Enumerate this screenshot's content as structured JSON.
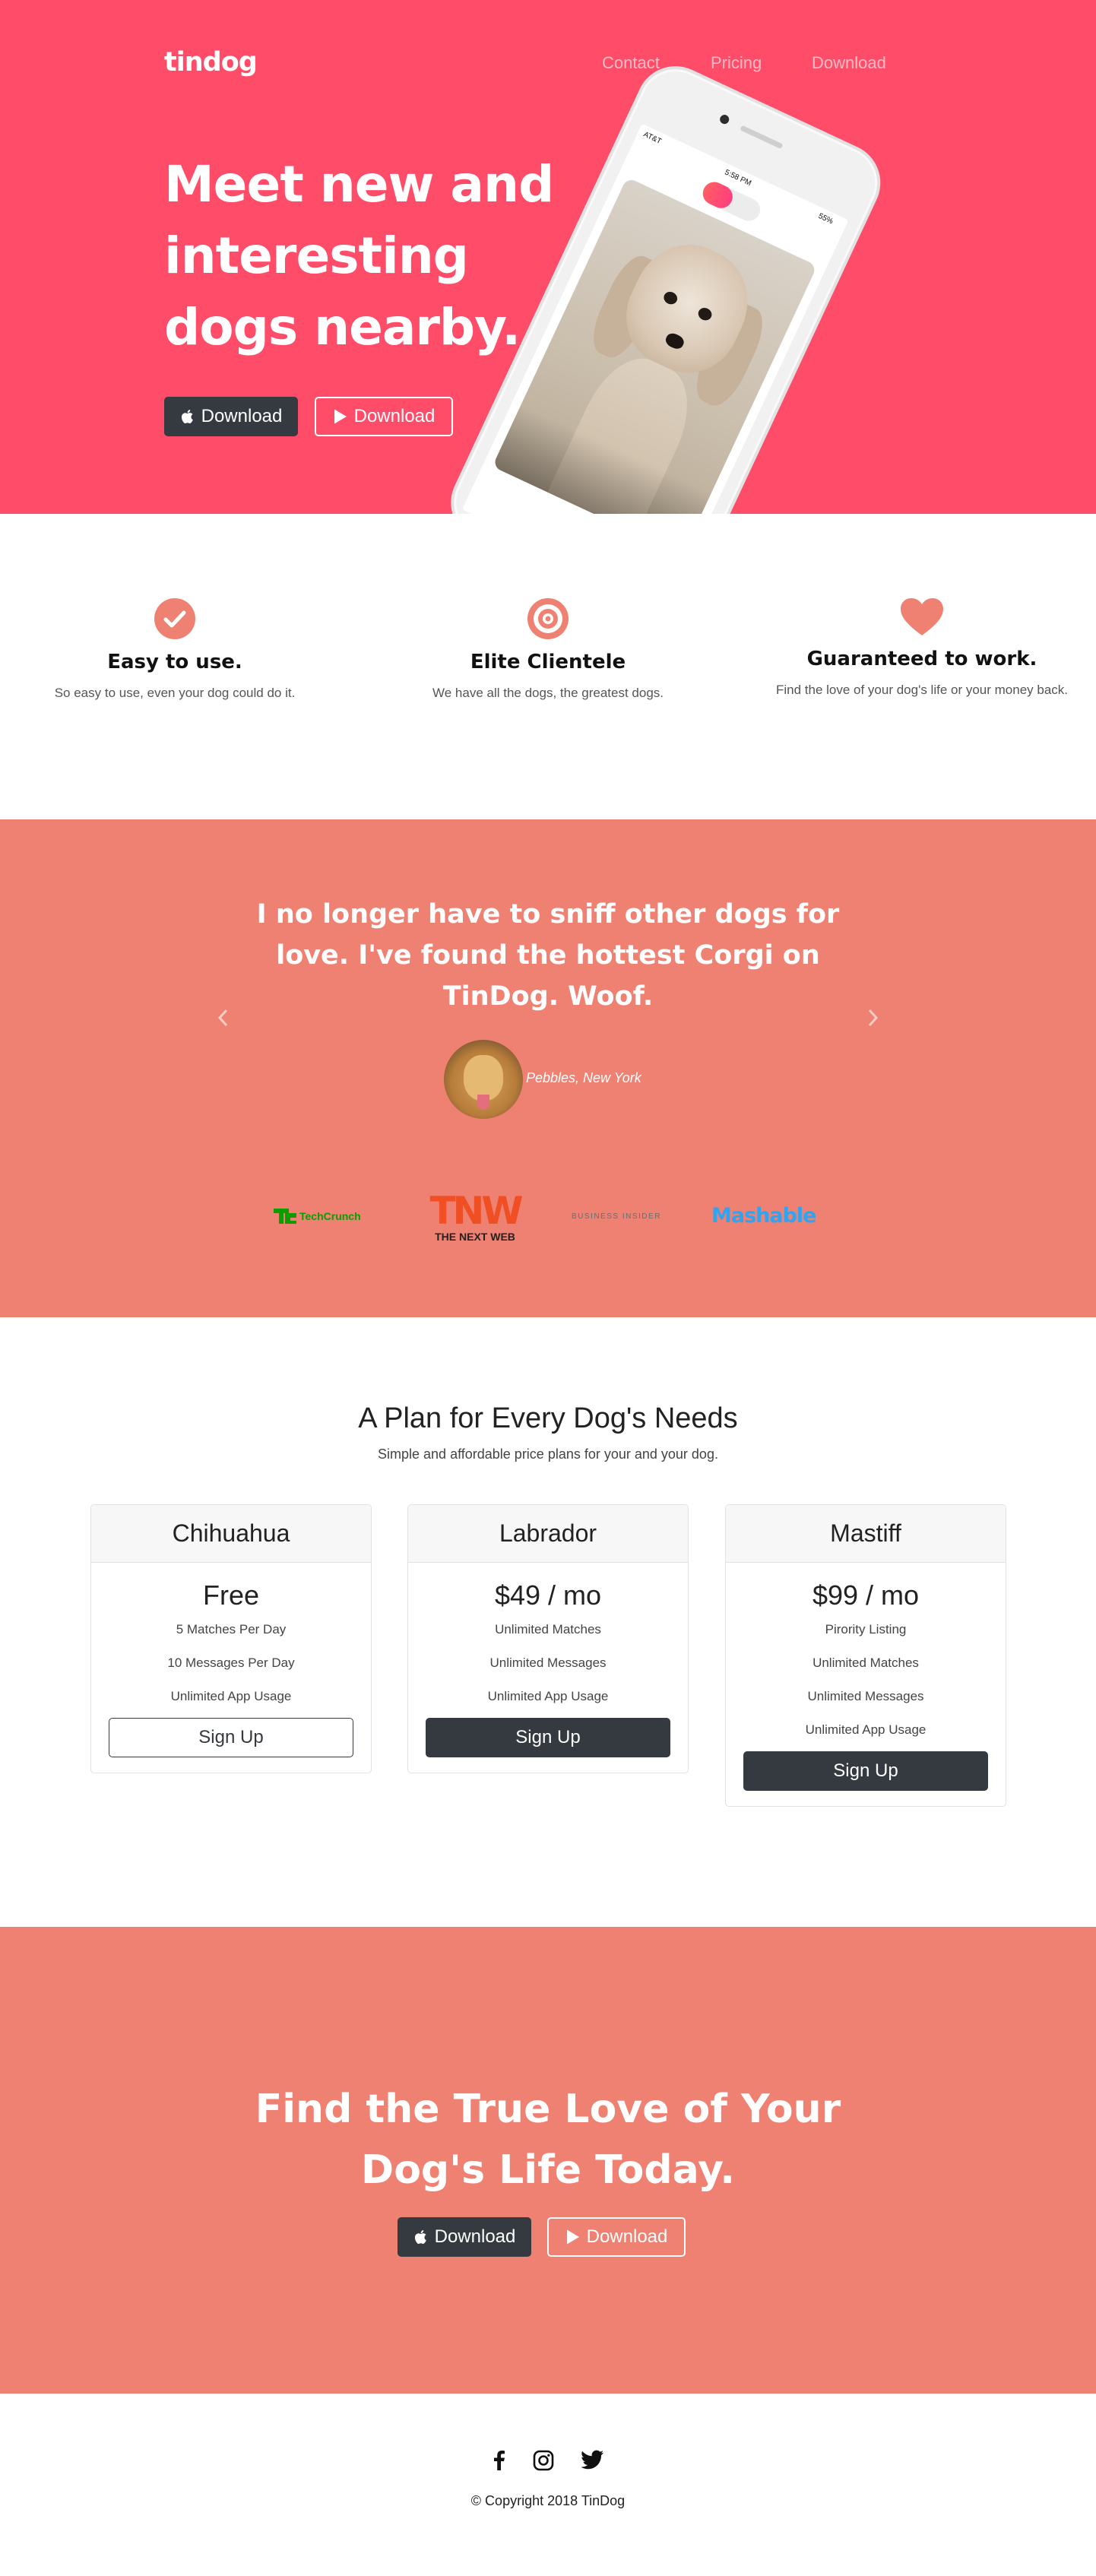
{
  "nav": {
    "brand": "tindog",
    "links": [
      "Contact",
      "Pricing",
      "Download"
    ]
  },
  "hero": {
    "title": "Meet new and interesting dogs nearby.",
    "buttons": [
      {
        "label": "Download",
        "icon": "apple-icon",
        "style": "dark"
      },
      {
        "label": "Download",
        "icon": "google-play-icon",
        "style": "outline-light"
      }
    ],
    "phone_status": {
      "carrier": "AT&T",
      "time": "5:58 PM",
      "battery": "55%"
    }
  },
  "features": [
    {
      "icon": "check-circle-icon",
      "title": "Easy to use.",
      "text": "So easy to use, even your dog could do it."
    },
    {
      "icon": "bullseye-icon",
      "title": "Elite Clientele",
      "text": "We have all the dogs, the greatest dogs."
    },
    {
      "icon": "heart-icon",
      "title": "Guaranteed to work.",
      "text": "Find the love of your dog's life or your money back."
    }
  ],
  "testimonial": {
    "quote": "I no longer have to sniff other dogs for love. I've found the hottest Corgi on TinDog. Woof.",
    "author": "Pebbles, New York"
  },
  "press": [
    "TechCrunch",
    "TNW",
    "THE NEXT WEB",
    "BUSINESS INSIDER",
    "Mashable"
  ],
  "pricing": {
    "title": "A Plan for Every Dog's Needs",
    "subtitle": "Simple and affordable price plans for your and your dog.",
    "plans": [
      {
        "name": "Chihuahua",
        "price": "Free",
        "features": [
          "5 Matches Per Day",
          "10 Messages Per Day",
          "Unlimited App Usage"
        ],
        "button": "Sign Up",
        "button_style": "outline"
      },
      {
        "name": "Labrador",
        "price": "$49 / mo",
        "features": [
          "Unlimited Matches",
          "Unlimited Messages",
          "Unlimited App Usage"
        ],
        "button": "Sign Up",
        "button_style": "solid"
      },
      {
        "name": "Mastiff",
        "price": "$99 / mo",
        "features": [
          "Pirority Listing",
          "Unlimited Matches",
          "Unlimited Messages",
          "Unlimited App Usage"
        ],
        "button": "Sign Up",
        "button_style": "solid"
      }
    ]
  },
  "cta": {
    "title": "Find the True Love of Your Dog's Life Today.",
    "buttons": [
      {
        "label": "Download",
        "icon": "apple-icon",
        "style": "dark"
      },
      {
        "label": "Download",
        "icon": "google-play-icon",
        "style": "outline-light"
      }
    ]
  },
  "footer": {
    "social": [
      "facebook-icon",
      "instagram-icon",
      "twitter-icon"
    ],
    "copyright": "© Copyright 2018 TinDog"
  },
  "colors": {
    "hero_bg": "#ff4c68",
    "section_bg": "#ef8172",
    "dark_button": "#343a40",
    "icon_accent": "#ef8172"
  }
}
